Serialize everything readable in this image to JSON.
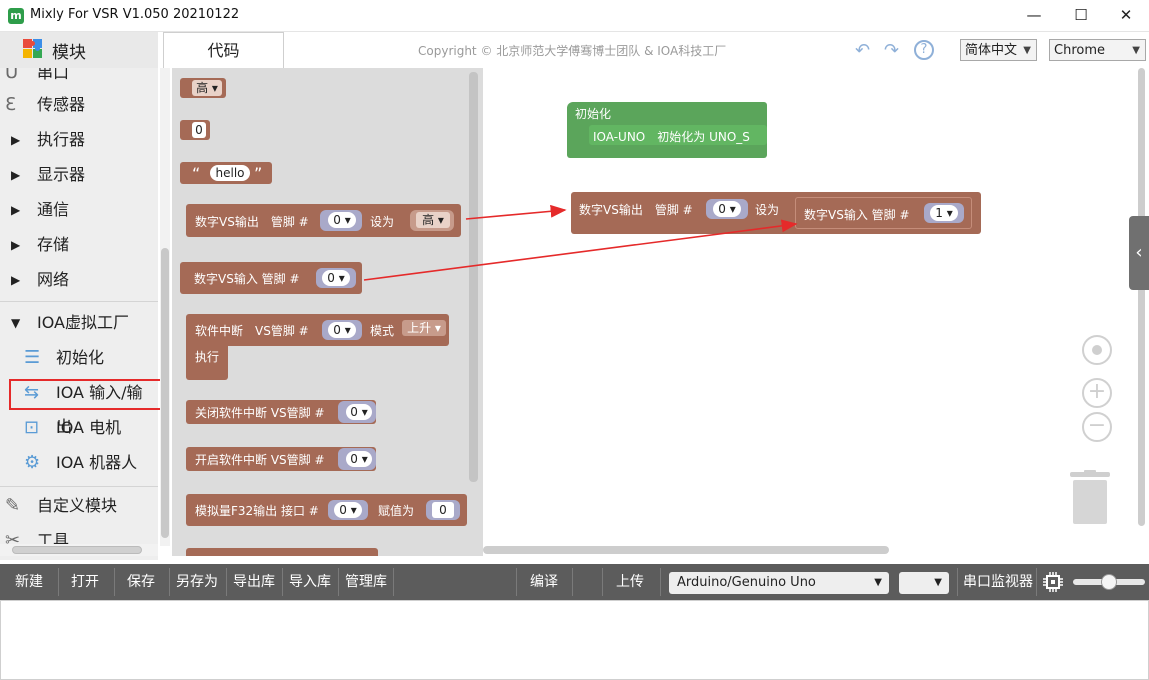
{
  "window": {
    "title": "Mixly For VSR V1.050 20210122",
    "app_icon_glyph": "m",
    "minimize": "—",
    "maximize": "☐",
    "close": "✕"
  },
  "header": {
    "blocks_tab": "模块",
    "code_tab": "代码",
    "copyright": "Copyright © 北京师范大学傅骞博士团队 & IOA科技工厂",
    "language": "简体中文",
    "browser": "Chrome",
    "undo_glyph": "↶",
    "redo_glyph": "↷",
    "help_glyph": "?"
  },
  "sidebar": {
    "categories": [
      {
        "label": "串口",
        "icon": "serial-icon",
        "glyph": "Ū"
      },
      {
        "label": "传感器",
        "icon": "sensor-icon",
        "glyph": "Ɛ"
      },
      {
        "label": "执行器",
        "icon": "expand-triangle-icon",
        "glyph": "▶"
      },
      {
        "label": "显示器",
        "icon": "expand-triangle-icon",
        "glyph": "▶"
      },
      {
        "label": "通信",
        "icon": "expand-triangle-icon",
        "glyph": "▶"
      },
      {
        "label": "存储",
        "icon": "expand-triangle-icon",
        "glyph": "▶"
      },
      {
        "label": "网络",
        "icon": "expand-triangle-icon",
        "glyph": "▶"
      },
      {
        "label": "IOA虚拟工厂",
        "icon": "collapse-triangle-icon",
        "glyph": "▼"
      }
    ],
    "subitems": [
      {
        "label": "初始化",
        "icon": "list-icon",
        "glyph": "☰"
      },
      {
        "label": "IOA 输入/输出",
        "icon": "io-icon",
        "glyph": "⇆"
      },
      {
        "label": "IOA 电机",
        "icon": "motor-icon",
        "glyph": "⊡"
      },
      {
        "label": "IOA 机器人",
        "icon": "robot-arm-icon",
        "glyph": "⚙"
      }
    ],
    "custom": {
      "label": "自定义模块",
      "icon": "pencil-icon",
      "glyph": "✎"
    },
    "tools": {
      "label": "工具",
      "icon": "tools-icon",
      "glyph": "✂"
    }
  },
  "flyout": {
    "b_high": "高",
    "b_zero": "0",
    "b_hello": "hello",
    "b_dout_label": "数字VS输出　管脚 #",
    "b_dout_pin": "0",
    "b_dout_set": "设为",
    "b_dout_val": "高",
    "b_din_label": "数字VS输入 管脚 #",
    "b_din_pin": "0",
    "b_int_label": "软件中断　VS管脚 #",
    "b_int_pin": "0",
    "b_int_mode": "模式",
    "b_int_mode_val": "上升",
    "b_int_exec": "执行",
    "b_close_int": "关闭软件中断 VS管脚 #",
    "b_close_pin": "0",
    "b_open_int": "开启软件中断 VS管脚 #",
    "b_open_pin": "0",
    "b_analog_label": "模拟量F32输出 接口 #",
    "b_analog_pin": "0",
    "b_analog_assign": "赋值为",
    "b_analog_val": "0"
  },
  "canvas": {
    "init_label": "初始化",
    "init_stmt": "IOA-UNO　初始化为 UNO_S",
    "set_label": "数字VS输出　管脚 #",
    "set_pin": "0",
    "set_to": "设为",
    "in_label": "数字VS输入 管脚 #",
    "in_pin": "1"
  },
  "toolbar": {
    "new": "新建",
    "open": "打开",
    "save": "保存",
    "save_as": "另存为",
    "export_lib": "导出库",
    "import_lib": "导入库",
    "manage_lib": "管理库",
    "compile": "编译",
    "upload": "上传",
    "board": "Arduino/Genuino Uno",
    "port": "",
    "serial_monitor": "串口监视器"
  },
  "colors": {
    "block_brown": "#a56a56",
    "block_green": "#5ba55b",
    "annotation_red": "#e52a2a",
    "toolbar_bg": "#5c5c5c"
  }
}
